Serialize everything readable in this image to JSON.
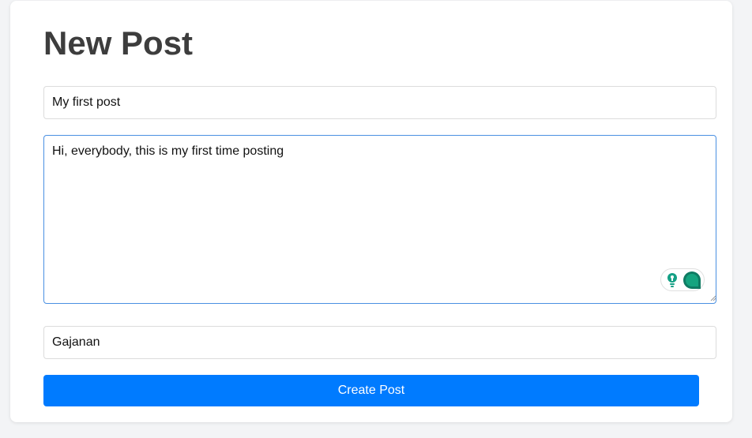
{
  "form": {
    "heading": "New Post",
    "title_value": "My first post",
    "content_value": "Hi, everybody, this is my first time posting",
    "author_value": "Gajanan",
    "submit_label": "Create Post"
  },
  "grammar_widget": {
    "icons": [
      "lightbulb-icon",
      "grammar-assistant-icon"
    ],
    "accent": "#14a085"
  },
  "colors": {
    "primary_button": "#007bff",
    "focus_border": "#4a90e2",
    "heading_text": "#3d3d3d"
  }
}
